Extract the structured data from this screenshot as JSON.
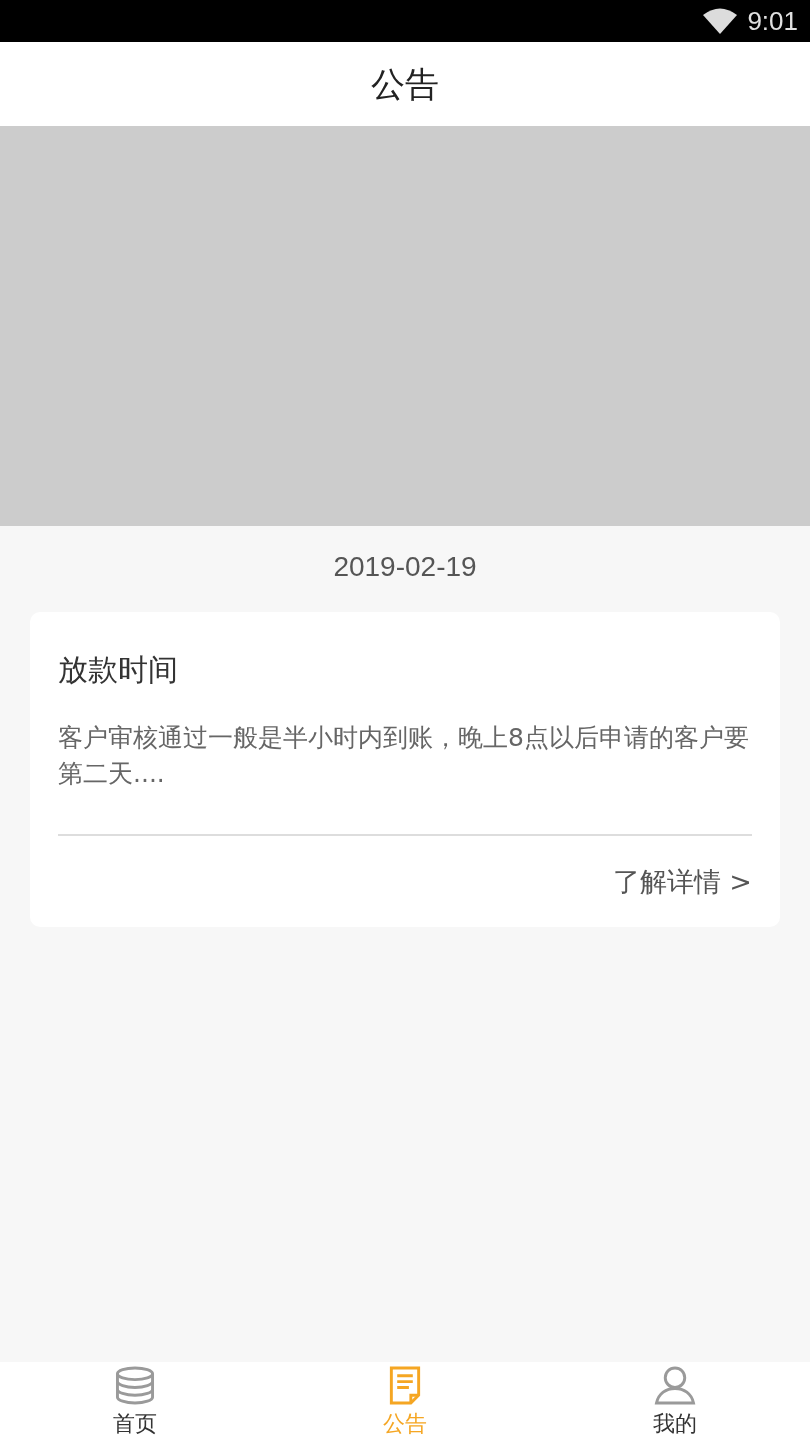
{
  "status_bar": {
    "time": "9:01"
  },
  "header": {
    "title": "公告"
  },
  "notices": [
    {
      "date": "2019-02-19",
      "title": "放款时间",
      "summary": "客户审核通过一般是半小时内到账，晚上8点以后申请的客户要第二天....",
      "link": "了解详情 >"
    }
  ],
  "tabs": [
    {
      "label": "首页",
      "kind": "coins",
      "selected": false
    },
    {
      "label": "公告",
      "kind": "notice",
      "selected": true
    },
    {
      "label": "我的",
      "kind": "person",
      "selected": false
    }
  ]
}
